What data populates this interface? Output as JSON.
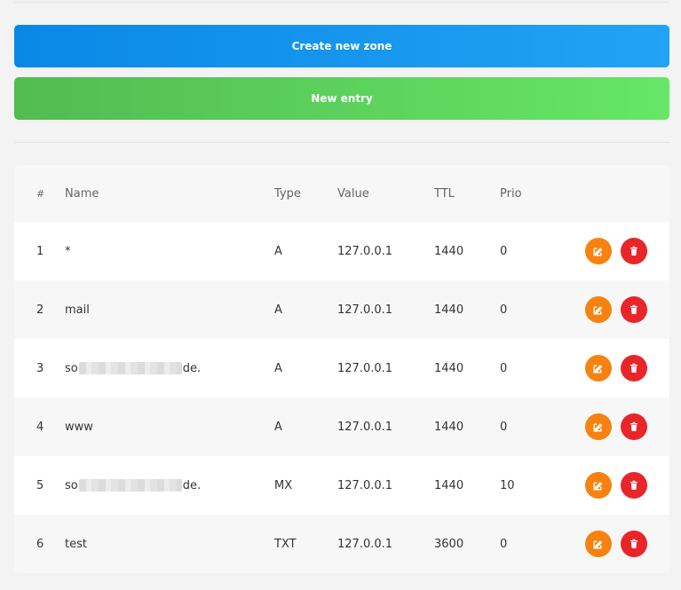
{
  "buttons": {
    "create_zone": "Create new zone",
    "new_entry": "New entry"
  },
  "table": {
    "headers": {
      "idx": "#",
      "name": "Name",
      "type": "Type",
      "value": "Value",
      "ttl": "TTL",
      "prio": "Prio"
    },
    "rows": [
      {
        "idx": "1",
        "name_prefix": "*",
        "name_suffix": "",
        "type": "A",
        "value": "127.0.0.1",
        "ttl": "1440",
        "prio": "0"
      },
      {
        "idx": "2",
        "name_prefix": "mail",
        "name_suffix": "",
        "type": "A",
        "value": "127.0.0.1",
        "ttl": "1440",
        "prio": "0"
      },
      {
        "idx": "3",
        "name_prefix": "so",
        "name_suffix": "de.",
        "type": "A",
        "value": "127.0.0.1",
        "ttl": "1440",
        "prio": "0"
      },
      {
        "idx": "4",
        "name_prefix": "www",
        "name_suffix": "",
        "type": "A",
        "value": "127.0.0.1",
        "ttl": "1440",
        "prio": "0"
      },
      {
        "idx": "5",
        "name_prefix": "so",
        "name_suffix": "de.",
        "type": "MX",
        "value": "127.0.0.1",
        "ttl": "1440",
        "prio": "10"
      },
      {
        "idx": "6",
        "name_prefix": "test",
        "name_suffix": "",
        "type": "TXT",
        "value": "127.0.0.1",
        "ttl": "3600",
        "prio": "0"
      }
    ]
  },
  "icons": {
    "edit": "edit-icon",
    "delete": "trash-icon"
  },
  "colors": {
    "primary": "#0a88e6",
    "success": "#53bb52",
    "edit": "#f7820f",
    "delete": "#e8262a"
  }
}
